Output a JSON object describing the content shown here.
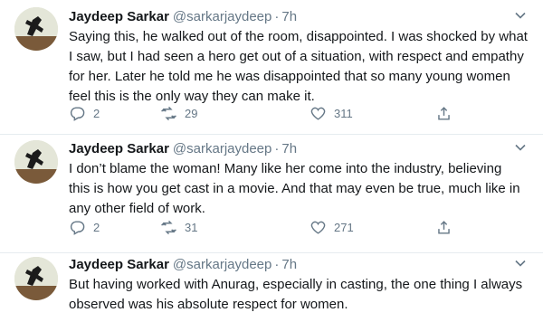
{
  "colors": {
    "name": "#14171a",
    "muted": "#657786",
    "divider": "#e6ecf0"
  },
  "icons": {
    "reply": "reply-icon",
    "retweet": "retweet-icon",
    "like": "heart-icon",
    "share": "share-icon",
    "caret": "chevron-down-icon"
  },
  "tweets": [
    {
      "author_name": "Jaydeep Sarkar",
      "author_handle": "@sarkarjaydeep",
      "separator": "·",
      "time": "7h",
      "lines": [
        "Saying this, he walked out of the room, disappointed. I was shocked by what",
        "I saw, but I had seen a hero get out of a situation, with respect and empathy",
        "for her. Later he told me he was disappointed that so many young women",
        "feel this is the only way they can make it."
      ],
      "replies": "2",
      "retweets": "29",
      "likes": "311"
    },
    {
      "author_name": "Jaydeep Sarkar",
      "author_handle": "@sarkarjaydeep",
      "separator": "·",
      "time": "7h",
      "lines": [
        "I don’t blame the woman! Many like her come into the industry, believing",
        "this is how you get cast in a movie. And that may even be true, much like in",
        "any other field of work."
      ],
      "replies": "2",
      "retweets": "31",
      "likes": "271"
    },
    {
      "author_name": "Jaydeep Sarkar",
      "author_handle": "@sarkarjaydeep",
      "separator": "·",
      "time": "7h",
      "lines": [
        "But having worked with Anurag, especially in casting, the one thing I always",
        "observed was his absolute respect for women."
      ]
    }
  ]
}
